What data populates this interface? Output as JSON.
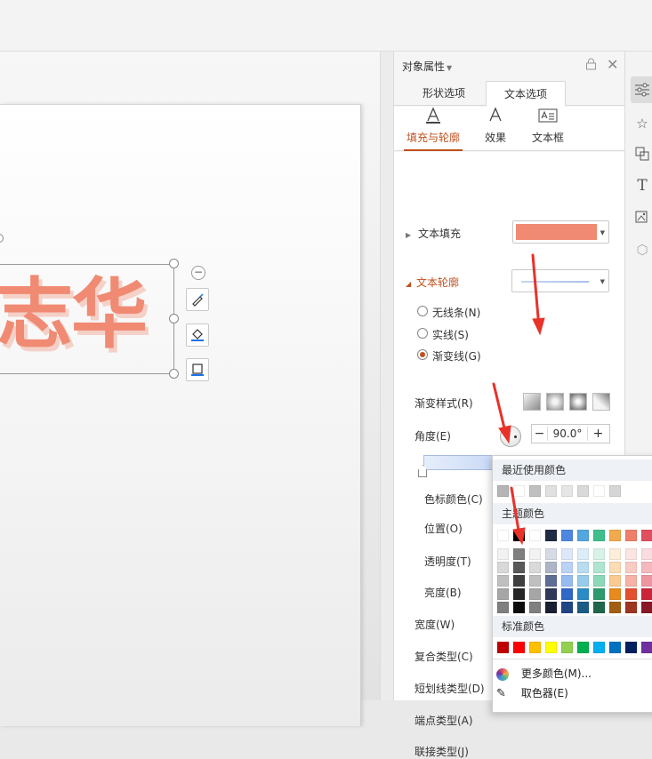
{
  "panel": {
    "title": "对象属性",
    "tabs": [
      "形状选项",
      "文本选项"
    ],
    "subtabs": [
      "填充与轮廓",
      "效果",
      "文本框"
    ],
    "text_fill_label": "文本填充",
    "text_fill_color": "#f08a72",
    "text_outline_label": "文本轮廓",
    "radios": [
      "无线条(N)",
      "实线(S)",
      "渐变线(G)"
    ],
    "gradient_style_label": "渐变样式(R)",
    "angle_label": "角度(E)",
    "angle_value": "90.0°",
    "stop_color_label": "色标颜色(C)",
    "stop_color_value": "#b7cdf2",
    "position_label": "位置(O)",
    "transparency_label": "透明度(T)",
    "brightness_label": "亮度(B)",
    "width_label": "宽度(W)",
    "compound_label": "复合类型(C)",
    "dash_label": "短划线类型(D)",
    "cap_label": "端点类型(A)",
    "join_label": "联接类型(J)"
  },
  "canvas": {
    "text": "志华"
  },
  "popup": {
    "recent_title": "最近使用颜色",
    "theme_title": "主题颜色",
    "standard_title": "标准颜色",
    "more_colors": "更多颜色(M)...",
    "eyedropper": "取色器(E)",
    "recent_colors": [
      "#b5b5b5",
      "#ffffff",
      "#c0c0c0",
      "#e0e0e0",
      "#e6e6e6",
      "#d9d9d9",
      "#ffffff",
      "#d6d6d6"
    ],
    "theme_top": [
      "#ffffff",
      "#000000",
      "#ffffff",
      "#1f2a44",
      "#4f86e0",
      "#52a7dd",
      "#3fbf8c",
      "#f3a94d",
      "#ef7f6a",
      "#e04f5f"
    ],
    "theme_shades": [
      [
        "#f2f2f2",
        "#7f7f7f",
        "#f2f2f2",
        "#d6dae4",
        "#dde8fa",
        "#dcedf8",
        "#d9f2e8",
        "#fdeeda",
        "#fce5e1",
        "#f9dcdf"
      ],
      [
        "#d9d9d9",
        "#595959",
        "#d9d9d9",
        "#aeb5c9",
        "#bad2f5",
        "#b9dcf1",
        "#b2e5d1",
        "#fbdcb6",
        "#f9ccc3",
        "#f3b9bf"
      ],
      [
        "#bfbfbf",
        "#3f3f3f",
        "#bfbfbf",
        "#5e6d94",
        "#96bbf0",
        "#96cbea",
        "#8cd9ba",
        "#f9cb91",
        "#f5b2a5",
        "#ee96a0"
      ],
      [
        "#a6a6a6",
        "#262626",
        "#a6a6a6",
        "#2f3a5a",
        "#2f68c6",
        "#2a8bc6",
        "#2e9b6f",
        "#e88a1d",
        "#e4502f",
        "#cb2538"
      ],
      [
        "#7f7f7f",
        "#0d0d0d",
        "#7f7f7f",
        "#1a2034",
        "#1f4585",
        "#1c5c84",
        "#1f674a",
        "#a15e12",
        "#9d3520",
        "#881826"
      ]
    ],
    "standard_colors": [
      "#c00000",
      "#ff0000",
      "#ffc000",
      "#ffff00",
      "#92d050",
      "#00b050",
      "#00b0f0",
      "#0070c0",
      "#002060",
      "#7030a0"
    ]
  },
  "colors": {
    "accent": "#c0501d",
    "arrow": "#e8322a"
  }
}
